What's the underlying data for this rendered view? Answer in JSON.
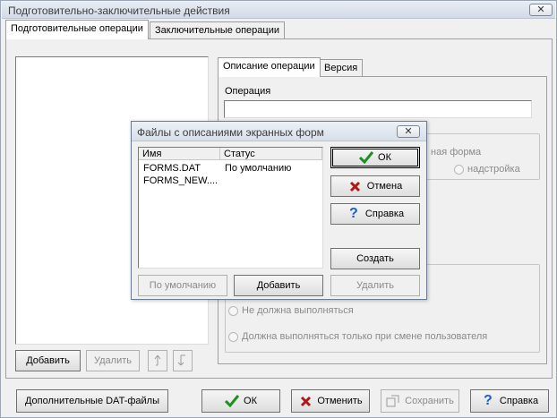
{
  "window": {
    "title": "Подготовительно-заключительные действия",
    "close_glyph": "✕"
  },
  "tabs": [
    {
      "label": "Подготовительные операции",
      "active": true
    },
    {
      "label": "Заключительные операции",
      "active": false
    }
  ],
  "inner_tabs": [
    {
      "label": "Описание операции",
      "active": true
    },
    {
      "label": "Версия",
      "active": false
    }
  ],
  "operation": {
    "label": "Операция",
    "value": ""
  },
  "form_group": {
    "option_screen_form": "ная форма",
    "option_addon": "надстройка"
  },
  "run_group": {
    "option_not_run": "Не должна выполняться",
    "option_on_user_change": "Должна выполняться только при смене пользователя"
  },
  "left_buttons": {
    "add": "Добавить",
    "delete": "Удалить"
  },
  "bottom_buttons": {
    "extra_dat": "Дополнительные DAT-файлы",
    "ok": "ОК",
    "cancel": "Отменить",
    "save": "Сохранить",
    "help": "Справка"
  },
  "dialog": {
    "title": "Файлы с описаниями экранных форм",
    "close_glyph": "✕",
    "columns": [
      "Имя",
      "Статус"
    ],
    "rows": [
      {
        "name": "FORMS.DAT",
        "status": "По умолчанию"
      },
      {
        "name": "FORMS_NEW....",
        "status": ""
      }
    ],
    "buttons": {
      "ok": "ОК",
      "cancel": "Отмена",
      "help": "Справка",
      "create": "Создать",
      "set_default": "По умолчанию",
      "add": "Добавить",
      "delete": "Удалить"
    }
  },
  "colors": {
    "ok_check": "#1f8f1f",
    "cancel_x": "#b01818",
    "help_q": "#1c5fc4"
  }
}
